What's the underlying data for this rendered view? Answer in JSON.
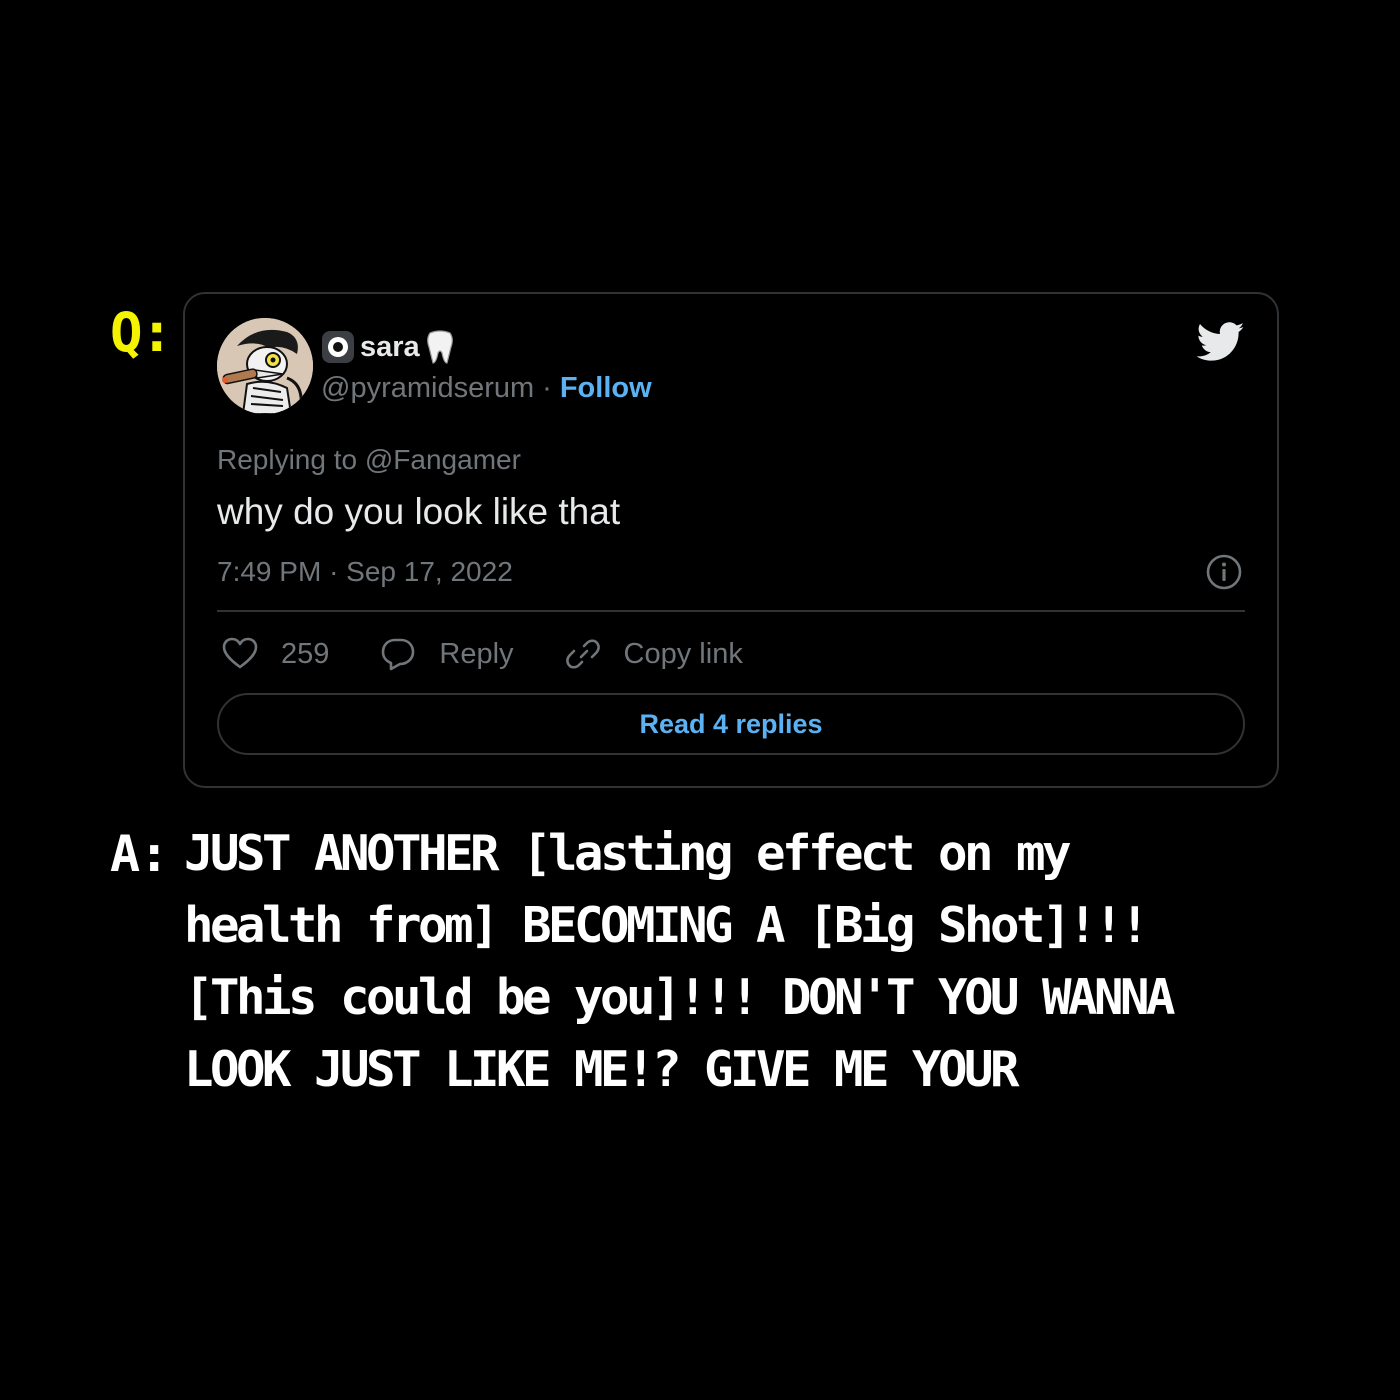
{
  "q_label": "Q:",
  "a_label": "A:",
  "tweet": {
    "display_name": "sara",
    "name_icons": [
      "eye-icon",
      "tooth-icon"
    ],
    "handle": "@pyramidserum",
    "separator": "·",
    "follow_label": "Follow",
    "replying_prefix": "Replying to",
    "replying_to": "@Fangamer",
    "text": "why do you look like that",
    "time": "7:49 PM",
    "date_separator": "·",
    "date": "Sep 17, 2022",
    "likes": "259",
    "reply_label": "Reply",
    "copy_link_label": "Copy link",
    "read_replies_label": "Read 4 replies",
    "brand_icon": "twitter-bird-icon"
  },
  "answer": {
    "lines": [
      "JUST ANOTHER [lasting effect on my",
      "health from] BECOMING A [Big Shot]!!!",
      "[This could be you]!!! DON'T YOU WANNA",
      "LOOK JUST LIKE ME!? GIVE ME YOUR"
    ]
  },
  "colors": {
    "background": "#000000",
    "q_label": "#f4f400",
    "answer_text": "#ffffff",
    "accent_blue": "#5cb1f2",
    "muted_text": "#71767b",
    "primary_text": "#e7e9ea",
    "border": "#2f3336"
  }
}
